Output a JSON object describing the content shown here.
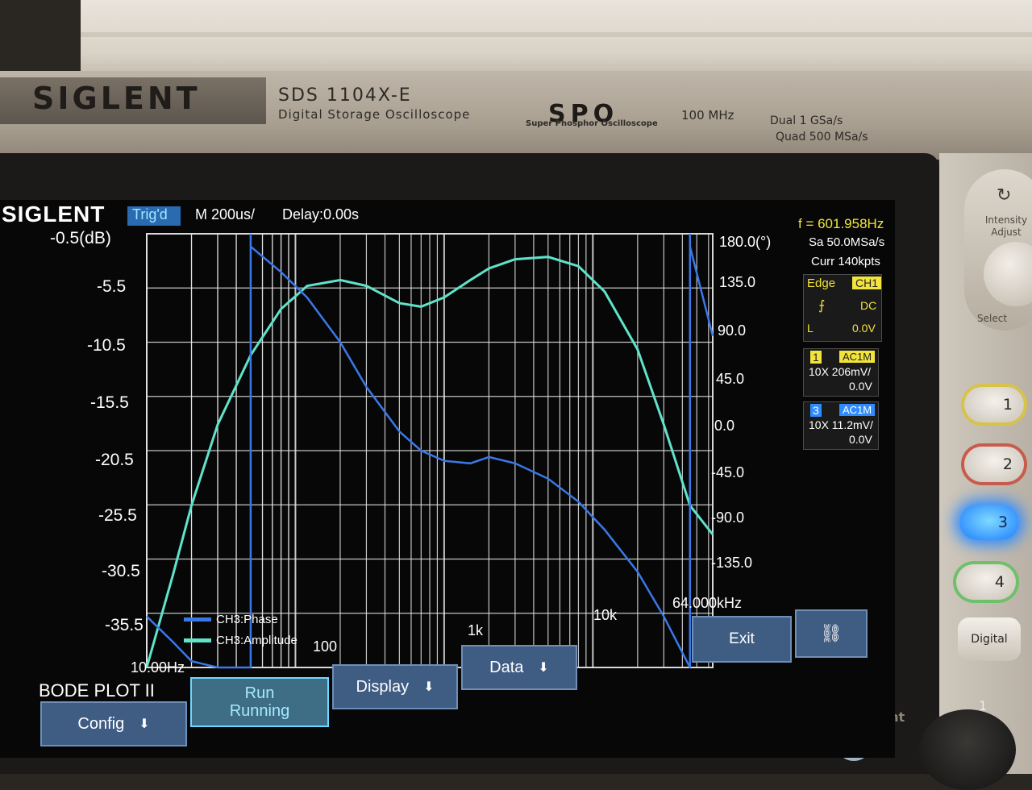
{
  "device": {
    "brand": "SIGLENT",
    "model": "SDS 1104X-E",
    "model_subtitle": "Digital Storage Oscilloscope",
    "spo": "SPO",
    "spo_subtitle": "Super Phosphor Oscilloscope",
    "bandwidth": "100 MHz",
    "rate_dual": "Dual  1 GSa/s",
    "rate_quad": "Quad  500 MSa/s",
    "intensity_label": "Intensity Adjust",
    "select_label": "Select",
    "channel_buttons": [
      "1",
      "2",
      "3",
      "4"
    ],
    "digital_label": "Digital",
    "print_label": "Print",
    "knob_label": "1"
  },
  "status_bar": {
    "logo": "SIGLENT",
    "trigger_state": "Trig'd",
    "timebase": "M 200us/",
    "delay": "Delay:0.00s",
    "frequency": "f = 601.958Hz",
    "sample_rate": "Sa 50.0MSa/s",
    "memory": "Curr 140kpts"
  },
  "trigger_panel": {
    "type": "Edge",
    "source": "CH1",
    "slope_icon": "rising-edge-icon",
    "coupling": "DC",
    "level_label": "L",
    "level_value": "0.0V"
  },
  "channels": [
    {
      "num": "1",
      "coupling": "AC1M",
      "scale": "10X  206mV/",
      "offset": "0.0V",
      "color": "#f3e43b"
    },
    {
      "num": "3",
      "coupling": "AC1M",
      "scale": "10X  11.2mV/",
      "offset": "0.0V",
      "color": "#2f8cff"
    }
  ],
  "bode": {
    "title": "BODE PLOT II",
    "amp_axis_labels": [
      "-0.5(dB)",
      "-5.5",
      "-10.5",
      "-15.5",
      "-20.5",
      "-25.5",
      "-30.5",
      "-35.5"
    ],
    "phase_axis_labels": [
      "180.0(°)",
      "135.0",
      "90.0",
      "45.0",
      "0.0",
      "-45.0",
      "-90.0",
      "-135.0"
    ],
    "freq_start": "10.00Hz",
    "freq_labels": [
      "100",
      "1k",
      "10k"
    ],
    "freq_end": "64.000kHz",
    "legend_phase": "CH3:Phase",
    "legend_amplitude": "CH3:Amplitude",
    "phase_color": "#3a78e8",
    "amplitude_color": "#5fe3c9"
  },
  "softkeys": {
    "config": "Config",
    "run_line1": "Run",
    "run_line2": "Running",
    "display": "Display",
    "data": "Data",
    "exit": "Exit",
    "network_icon": "network-icon"
  },
  "chart_data": {
    "type": "line",
    "xlabel": "",
    "ylabel": "(dB)",
    "y2label": "(°)",
    "x_scale": "log",
    "xlim": [
      10,
      64000
    ],
    "ylim": [
      -38,
      -0.5
    ],
    "y2lim": [
      -160,
      180
    ],
    "grid": true,
    "legend_placement": "bottom-left",
    "series": [
      {
        "name": "CH3:Amplitude",
        "axis": "left",
        "x": [
          10,
          15,
          20,
          30,
          50,
          80,
          120,
          200,
          300,
          500,
          700,
          1000,
          1500,
          2000,
          3000,
          5000,
          8000,
          12000,
          20000,
          30000,
          45000,
          64000
        ],
        "values": [
          -38,
          -30,
          -24,
          -17,
          -11,
          -7,
          -5,
          -4.5,
          -5,
          -6.5,
          -6.8,
          -6,
          -4.5,
          -3.5,
          -2.7,
          -2.5,
          -3.3,
          -5.5,
          -10.5,
          -17,
          -24,
          -26.5
        ]
      },
      {
        "name": "CH3:Phase",
        "axis": "right",
        "x": [
          10,
          15,
          20,
          30,
          50,
          80,
          120,
          200,
          300,
          500,
          700,
          1000,
          1500,
          2000,
          3000,
          5000,
          8000,
          12000,
          20000,
          30000,
          45000,
          64000
        ],
        "values": [
          -120,
          -140,
          -155,
          -160,
          170,
          150,
          130,
          95,
          60,
          25,
          10,
          2,
          0,
          5,
          0,
          -12,
          -30,
          -52,
          -85,
          -120,
          170,
          100
        ]
      }
    ]
  }
}
